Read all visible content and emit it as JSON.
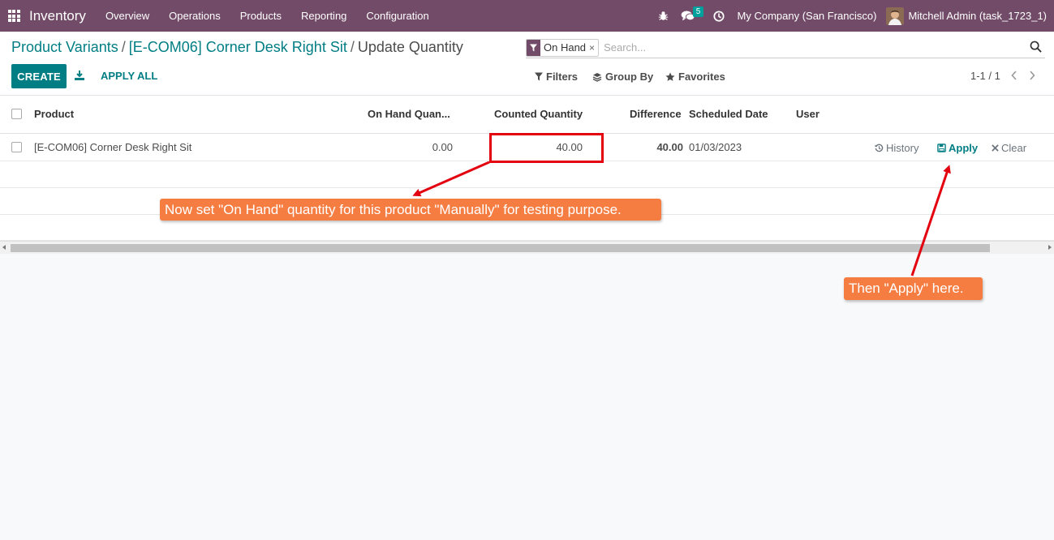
{
  "navbar": {
    "app_name": "Inventory",
    "menu": [
      "Overview",
      "Operations",
      "Products",
      "Reporting",
      "Configuration"
    ],
    "messages_badge": "5",
    "company": "My Company (San Francisco)",
    "user": "Mitchell Admin (task_1723_1)",
    "bar_color": "#714b67"
  },
  "breadcrumb": {
    "items": [
      "Product Variants",
      "[E-COM06] Corner Desk Right Sit"
    ],
    "current": "Update Quantity"
  },
  "toolbar": {
    "create_label": "CREATE",
    "apply_all_label": "APPLY ALL"
  },
  "search": {
    "facet_label": "On Hand",
    "placeholder": "Search..."
  },
  "filters": {
    "filters_label": "Filters",
    "group_by_label": "Group By",
    "favorites_label": "Favorites"
  },
  "pager": {
    "text": "1-1 / 1"
  },
  "table": {
    "headers": [
      "Product",
      "On Hand Quan...",
      "Counted Quantity",
      "Difference",
      "Scheduled Date",
      "User"
    ],
    "rows": [
      {
        "product": "[E-COM06] Corner Desk Right Sit",
        "on_hand": "0.00",
        "counted": "40.00",
        "difference": "40.00",
        "scheduled_date": "01/03/2023",
        "user": "",
        "history_label": "History",
        "apply_label": "Apply",
        "clear_label": "Clear"
      }
    ]
  },
  "annotations": {
    "callout_1": "Now set \"On Hand\" quantity for this product \"Manually\" for testing purpose.",
    "callout_2": "Then \"Apply\" here.",
    "callout_color": "#f57d42",
    "highlight_color": "#e3000f"
  },
  "colors": {
    "accent": "#017e84",
    "difference_positive": "#28a745"
  }
}
